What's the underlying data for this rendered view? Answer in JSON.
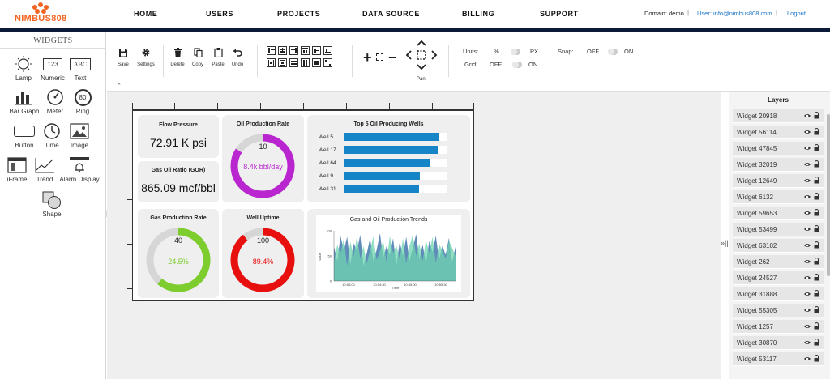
{
  "brand": {
    "name": "NIMBUS808",
    "color": "#f26522"
  },
  "nav": {
    "items": [
      "HOME",
      "USERS",
      "PROJECTS",
      "DATA SOURCE",
      "BILLING",
      "SUPPORT"
    ],
    "domain": "Domain: demo",
    "user": "User: info@nimbus808.com",
    "logout": "Logout"
  },
  "widgets": {
    "title": "WIDGETS",
    "items": [
      {
        "label": "Lamp",
        "icon": "lamp-icon"
      },
      {
        "label": "Numeric",
        "icon": "numeric-icon",
        "glyph": "123"
      },
      {
        "label": "Text",
        "icon": "text-icon",
        "glyph": "ABC"
      },
      {
        "label": "Bar Graph",
        "icon": "bar-graph-icon"
      },
      {
        "label": "Meter",
        "icon": "meter-icon"
      },
      {
        "label": "Ring",
        "icon": "ring-icon",
        "glyph": "80"
      },
      {
        "label": "Button",
        "icon": "button-icon"
      },
      {
        "label": "Time",
        "icon": "clock-icon"
      },
      {
        "label": "Image",
        "icon": "image-icon"
      },
      {
        "label": "iFrame",
        "icon": "iframe-icon"
      },
      {
        "label": "Trend",
        "icon": "trend-icon"
      },
      {
        "label": "Alarm Display",
        "icon": "alarm-icon"
      },
      {
        "label": "Shape",
        "icon": "shape-icon"
      }
    ]
  },
  "toolbar": {
    "save": "Save",
    "settings": "Settings",
    "delete": "Delete",
    "copy": "Copy",
    "paste": "Paste",
    "undo": "Undo",
    "pan": "Pan",
    "units_label": "Units:",
    "units_off": "%",
    "units_on": "PX",
    "snap_label": "Snap:",
    "snap_off": "OFF",
    "snap_on": "ON",
    "grid_label": "Grid:",
    "grid_off": "OFF",
    "grid_on": "ON"
  },
  "dashboard": {
    "flow_pressure": {
      "title": "Flow Pressure",
      "value": "72.91 K psi"
    },
    "gor": {
      "title": "Gas Oil Ratio (GOR)",
      "value": "865.09 mcf/bbl"
    },
    "oil_rate": {
      "title": "Oil Production Rate",
      "value": "8.4k bbl/day",
      "max": "10",
      "fraction": 0.84,
      "color": "#b926d0"
    },
    "gas_rate": {
      "title": "Gas Production Rate",
      "value": "24.5%",
      "max": "40",
      "fraction": 0.613,
      "color": "#7dcd2e"
    },
    "uptime": {
      "title": "Well Uptime",
      "value": "89.4%",
      "max": "100",
      "fraction": 0.894,
      "color": "#e80f0f"
    },
    "top_wells": {
      "title": "Top 5 Oil Producing Wells",
      "bars": [
        {
          "label": "Well 5",
          "fraction": 0.93
        },
        {
          "label": "Well 17",
          "fraction": 0.91
        },
        {
          "label": "Well 64",
          "fraction": 0.83
        },
        {
          "label": "Well 9",
          "fraction": 0.74
        },
        {
          "label": "Well 31",
          "fraction": 0.73
        }
      ],
      "color": "#1585c8"
    },
    "trend": {
      "title": "Gas and Oil Production Trends",
      "ylabel": "Value",
      "xlabel": "Time",
      "yticks": [
        "100",
        "50",
        "0"
      ],
      "xticks": [
        "10:54:00",
        "10:54:30",
        "10:55:00",
        "10:55:30"
      ],
      "series_a": [
        68,
        40,
        90,
        60,
        88,
        35,
        75,
        60,
        92,
        30,
        55,
        85,
        40,
        62,
        95,
        45,
        70,
        52,
        85,
        30,
        78,
        50,
        88,
        40,
        66,
        93,
        45,
        72,
        35,
        80,
        58,
        90,
        42,
        70,
        52,
        86,
        38,
        68
      ],
      "series_b": [
        40,
        72,
        55,
        85,
        30,
        78,
        50,
        90,
        45,
        70,
        35,
        62,
        88,
        42,
        60,
        80,
        38,
        90,
        55,
        72,
        44,
        85,
        35,
        70,
        92,
        50,
        75,
        40,
        82,
        56,
        88,
        36,
        74,
        60,
        45,
        80,
        66,
        50
      ],
      "color_a": "#4f7db3",
      "color_b": "#6fd4b0"
    }
  },
  "layers": {
    "title": "Layers",
    "items": [
      "Widget 20918",
      "Widget 56114",
      "Widget 47845",
      "Widget 32019",
      "Widget 12649",
      "Widget 6132",
      "Widget 59653",
      "Widget 53499",
      "Widget 63102",
      "Widget 262",
      "Widget 24527",
      "Widget 31888",
      "Widget 55305",
      "Widget 1257",
      "Widget 30870",
      "Widget 53117"
    ]
  }
}
